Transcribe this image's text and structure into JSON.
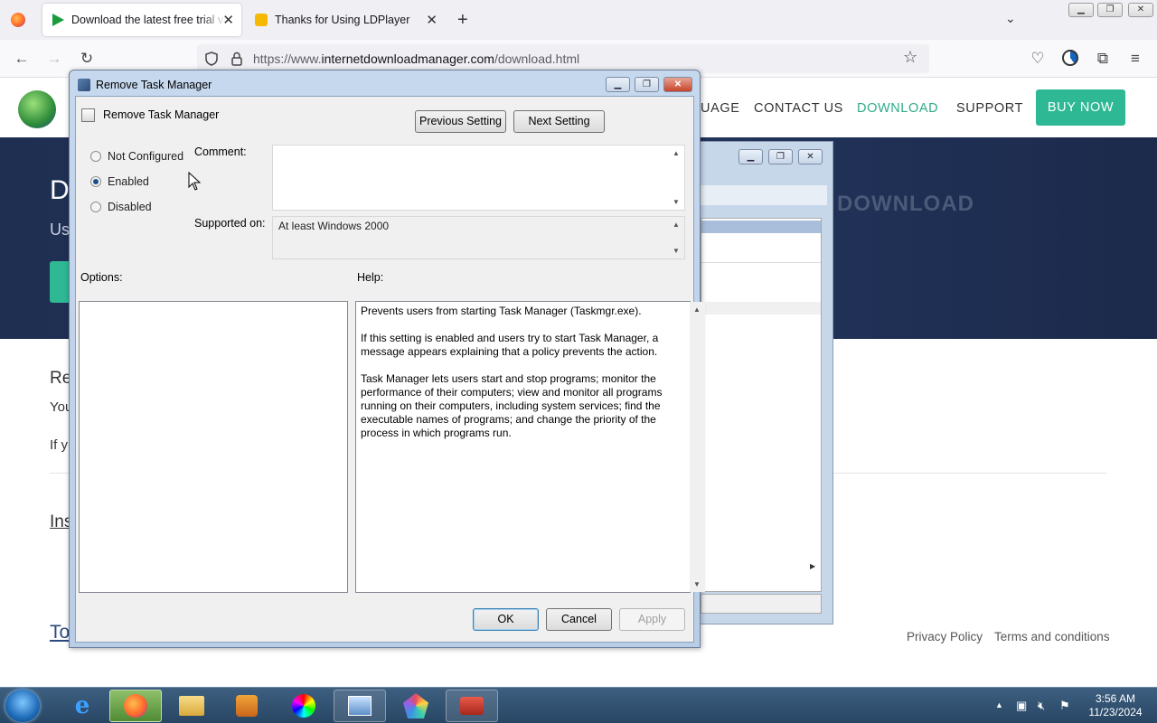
{
  "browser": {
    "tabs": [
      {
        "label": "Download the latest free trial ve",
        "active": true
      },
      {
        "label": "Thanks for Using LDPlayer",
        "active": false
      }
    ],
    "url_prefix": "https://www.",
    "url_host": "internetdownloadmanager.com",
    "url_path": "/download.html"
  },
  "site": {
    "nav": [
      "UAGE",
      "CONTACT US",
      "DOWNLOAD",
      "SUPPORT"
    ],
    "buy_now": "BUY NOW",
    "hero_title": "D",
    "hero_sub": "Us",
    "hero_watermark": "DOWNLOAD",
    "text_re": "Re",
    "text_you": "You",
    "text_if": "If y",
    "text_ins": "Ins",
    "text_to": "To",
    "footer_links": [
      "Privacy Policy",
      "Terms and conditions"
    ]
  },
  "dialog": {
    "title": "Remove Task Manager",
    "setting_name": "Remove Task Manager",
    "prev_button": "Previous Setting",
    "next_button": "Next Setting",
    "radios": [
      {
        "label": "Not Configured",
        "checked": false
      },
      {
        "label": "Enabled",
        "checked": true
      },
      {
        "label": "Disabled",
        "checked": false
      }
    ],
    "comment_label": "Comment:",
    "comment_value": "",
    "supported_label": "Supported on:",
    "supported_value": "At least Windows 2000",
    "options_label": "Options:",
    "help_label": "Help:",
    "help_text": "Prevents users from starting Task Manager (Taskmgr.exe).\n\nIf this setting is enabled and users try to start Task Manager, a message appears explaining that a policy prevents the action.\n\nTask Manager lets users start and stop programs; monitor the performance of their computers; view and monitor all programs running on their computers, including system services; find the executable names of programs; and change the priority of the process in which programs run.",
    "ok": "OK",
    "cancel": "Cancel",
    "apply": "Apply"
  },
  "taskbar": {
    "time": "3:56 AM",
    "date": "11/23/2024"
  },
  "colors": {
    "accent": "#2eb894",
    "hero_bg": "#22345c",
    "taskbar": "#2f4f70"
  }
}
